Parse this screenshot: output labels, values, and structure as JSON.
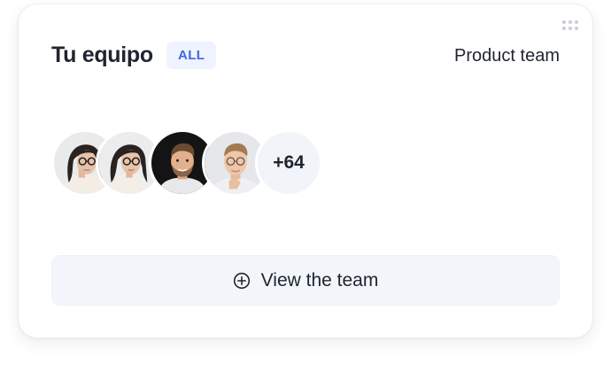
{
  "header": {
    "title": "Tu equipo",
    "badge": "ALL",
    "team_name": "Product team"
  },
  "members": {
    "avatars": [
      {
        "name": "member-1",
        "icon": "woman-with-glasses-avatar"
      },
      {
        "name": "member-2",
        "icon": "woman-with-glasses-avatar"
      },
      {
        "name": "member-3",
        "icon": "bearded-man-avatar"
      },
      {
        "name": "member-4",
        "icon": "man-with-glasses-avatar"
      }
    ],
    "more_count": "+64"
  },
  "actions": {
    "view_team_label": "View the team",
    "view_team_icon": "plus-circle-icon"
  },
  "colors": {
    "accent": "#3f66e0",
    "badge_bg": "#eef3fd",
    "button_bg": "#f2f5f9",
    "text": "#1f2430"
  }
}
